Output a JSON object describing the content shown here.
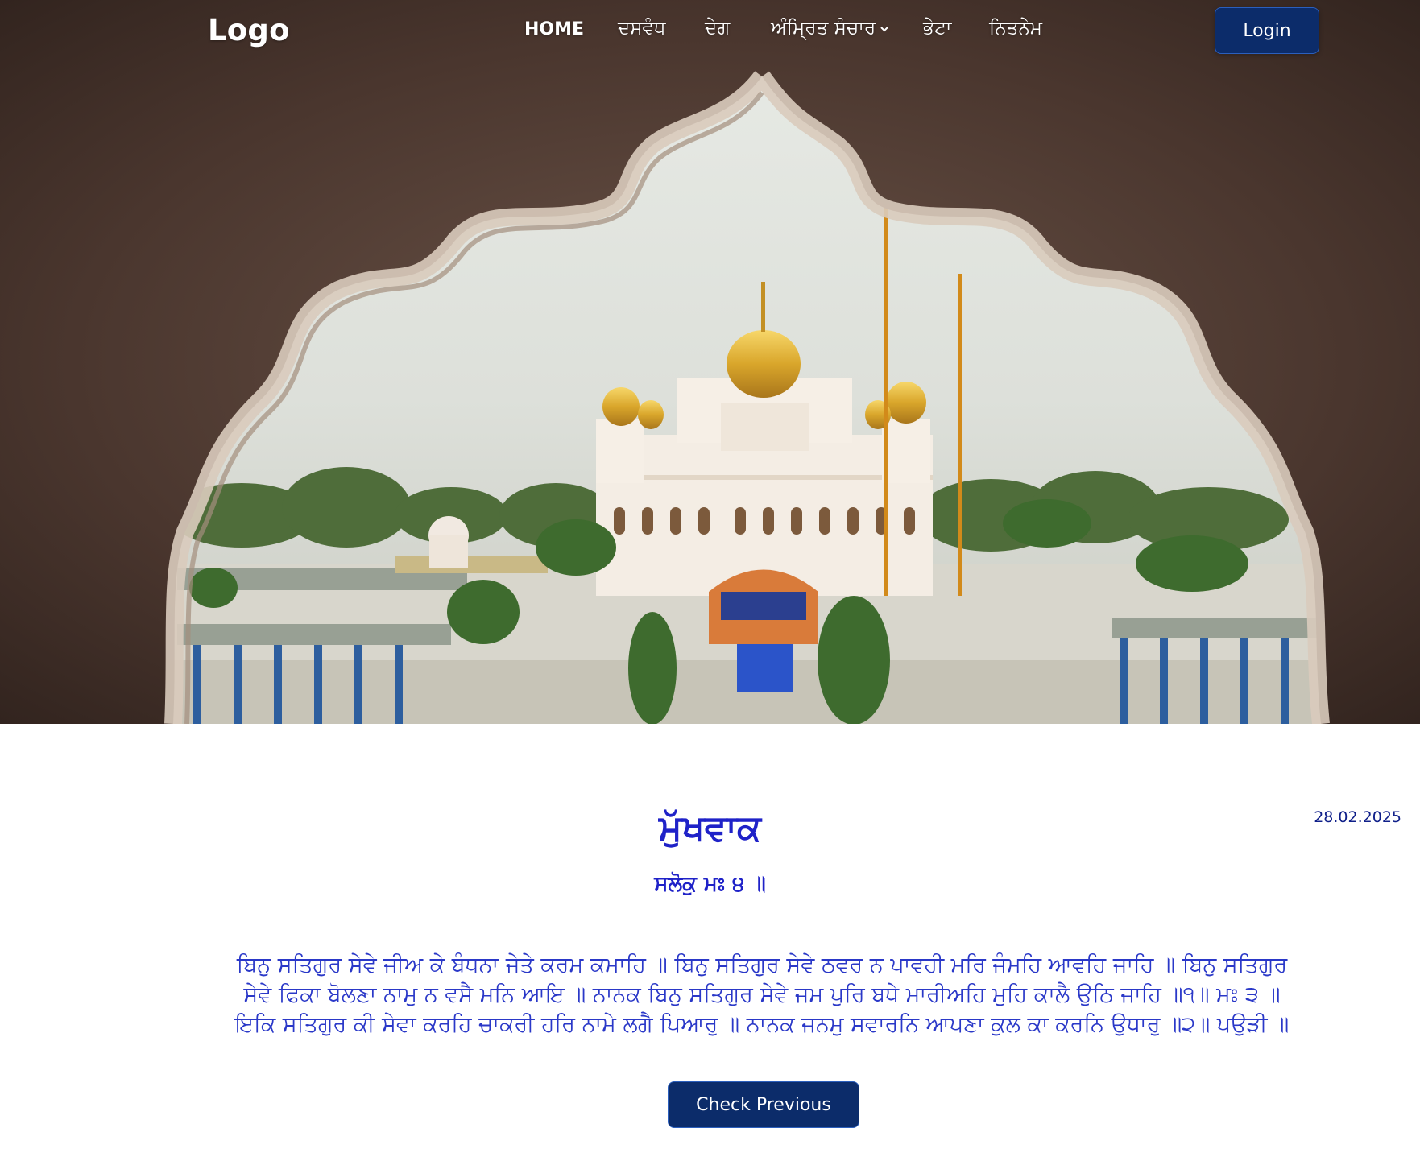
{
  "nav": {
    "logo": "Logo",
    "items": [
      {
        "label": "HOME"
      },
      {
        "label": "ਦਸਵੰਧ"
      },
      {
        "label": "ਦੇਗ"
      },
      {
        "label": "ਅੰਮ੍ਰਿਤ ਸੰਚਾਰ",
        "has_dropdown": true
      },
      {
        "label": "ਭੇਟਾ"
      },
      {
        "label": "ਨਿਤਨੇਮ"
      }
    ],
    "login_label": "Login"
  },
  "hero": {
    "image": "gurdwara-through-scalloped-arch"
  },
  "hukamnama": {
    "date": "28.02.2025",
    "title": "ਮੁੱਖਵਾਕ",
    "subtitle": "ਸਲੋਕੁ ਮਃ ੪ ॥",
    "verse": "ਬਿਨੁ ਸਤਿਗੁਰ ਸੇਵੇ ਜੀਅ ਕੇ ਬੰਧਨਾ ਜੇਤੇ ਕਰਮ ਕਮਾਹਿ ॥ ਬਿਨੁ ਸਤਿਗੁਰ ਸੇਵੇ ਠਵਰ ਨ ਪਾਵਹੀ ਮਰਿ ਜੰਮਹਿ ਆਵਹਿ ਜਾਹਿ ॥ ਬਿਨੁ ਸਤਿਗੁਰ ਸੇਵੇ ਫਿਕਾ ਬੋਲਣਾ ਨਾਮੁ ਨ ਵਸੈ ਮਨਿ ਆਇ ॥ ਨਾਨਕ ਬਿਨੁ ਸਤਿਗੁਰ ਸੇਵੇ ਜਮ ਪੁਰਿ ਬਧੇ ਮਾਰੀਅਹਿ ਮੁਹਿ ਕਾਲੈ ਉਠਿ ਜਾਹਿ ॥੧॥ ਮਃ ੩ ॥ ਇਕਿ ਸਤਿਗੁਰ ਕੀ ਸੇਵਾ ਕਰਹਿ ਚਾਕਰੀ ਹਰਿ ਨਾਮੇ ਲਗੈ ਪਿਆਰੁ ॥ ਨਾਨਕ ਜਨਮੁ ਸਵਾਰਨਿ ਆਪਣਾ ਕੁਲ ਕਾ ਕਰਨਿ ਉਧਾਰੁ ॥੨॥ ਪਉੜੀ ॥",
    "button_label": "Check Previous"
  },
  "colors": {
    "brand_navy": "#0c2c6a",
    "gurbani_blue": "#1f22c8",
    "white": "#ffffff"
  }
}
